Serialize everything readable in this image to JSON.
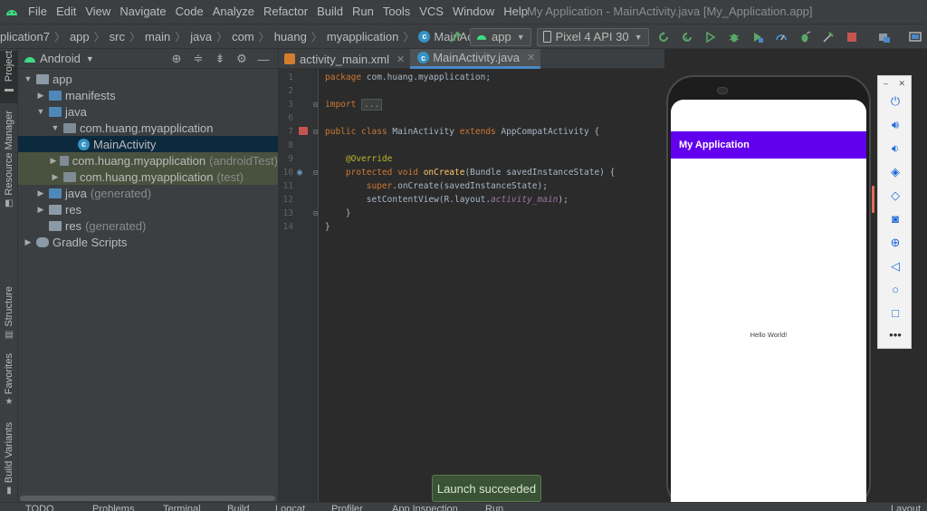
{
  "menu": {
    "items": [
      "File",
      "Edit",
      "View",
      "Navigate",
      "Code",
      "Analyze",
      "Refactor",
      "Build",
      "Run",
      "Tools",
      "VCS",
      "Window",
      "Help"
    ],
    "window_title": "My Application - MainActivity.java [My_Application.app]"
  },
  "nav": {
    "crumbs": [
      "plication7",
      "app",
      "src",
      "main",
      "java",
      "com",
      "huang",
      "myapplication",
      "MainActivity"
    ],
    "run_config": "app",
    "device": "Pixel 4 API 30"
  },
  "left_strip": {
    "tabs": [
      "Project",
      "Resource Manager",
      "Structure",
      "Favorites",
      "Build Variants"
    ]
  },
  "project": {
    "view_mode": "Android",
    "tree": [
      {
        "label": "app",
        "muted": ""
      },
      {
        "label": "manifests",
        "muted": ""
      },
      {
        "label": "java",
        "muted": ""
      },
      {
        "label": "com.huang.myapplication",
        "muted": ""
      },
      {
        "label": "MainActivity",
        "muted": ""
      },
      {
        "label": "com.huang.myapplication",
        "muted": "(androidTest)"
      },
      {
        "label": "com.huang.myapplication",
        "muted": "(test)"
      },
      {
        "label": "java",
        "muted": "(generated)"
      },
      {
        "label": "res",
        "muted": ""
      },
      {
        "label": "res",
        "muted": "(generated)"
      },
      {
        "label": "Gradle Scripts",
        "muted": ""
      }
    ]
  },
  "editor": {
    "tabs": [
      "activity_main.xml",
      "MainActivity.java"
    ],
    "line_numbers": [
      "1",
      "2",
      "3",
      "6",
      "7",
      "8",
      "9",
      "10",
      "11",
      "12",
      "13",
      "14"
    ],
    "code": {
      "l1_kw": "package",
      "l1_rest": " com.huang.myapplication;",
      "l3_kw": "import",
      "l3_fold": "...",
      "l7_kw": "public class",
      "l7_name": " MainActivity ",
      "l7_kw2": "extends",
      "l7_rest": " AppCompatActivity {",
      "l9_ann": "@Override",
      "l10_kw": "protected void",
      "l10_fn": " onCreate",
      "l10_rest": "(Bundle savedInstanceState) {",
      "l11_kw": "super",
      "l11_rest": ".onCreate(savedInstanceState);",
      "l12_a": "setContentView(R.layout.",
      "l12_it": "activity_main",
      "l12_b": ");",
      "l13": "}",
      "l14": "}"
    }
  },
  "emulator": {
    "app_title": "My Application",
    "hello_text": "Hello World!",
    "controls": [
      "power-icon",
      "volume-up-icon",
      "volume-down-icon",
      "rotate-left-icon",
      "rotate-right-icon",
      "camera-icon",
      "zoom-icon",
      "back-icon",
      "home-icon",
      "overview-icon",
      "more-icon"
    ]
  },
  "toast": "Launch succeeded",
  "bottom": {
    "items": [
      "TODO",
      "Problems",
      "Terminal",
      "Build",
      "Logcat",
      "Profiler",
      "App Inspection",
      "Run",
      "Layout"
    ]
  },
  "colors": {
    "app_bar": "#6200ee",
    "accent": "#4a88c7",
    "toast_bg": "#3a5236"
  }
}
